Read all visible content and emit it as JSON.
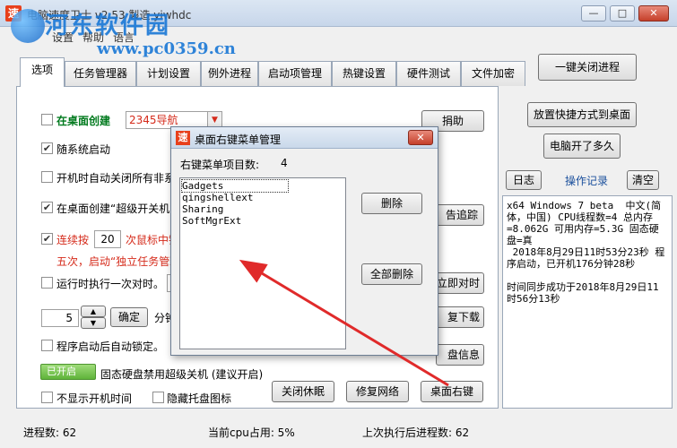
{
  "window": {
    "title": "电脑速度卫士 v2.53  製造 yiwhdc",
    "minimize_glyph": "—",
    "maximize_glyph": "□",
    "close_glyph": "✕"
  },
  "watermark": {
    "line1": "河东软件园",
    "line2": "www.pc0359.cn"
  },
  "menu": [
    "设置",
    "帮助",
    "语言"
  ],
  "tabs": [
    "选项",
    "任务管理器",
    "计划设置",
    "例外进程",
    "启动项管理",
    "热键设置",
    "硬件测试",
    "文件加密"
  ],
  "top_button": "一键关闭进程",
  "options": {
    "desktop_create": "在桌面创建",
    "desktop_select_value": "2345导航",
    "donate": "捐助",
    "autostart": "随系统启动",
    "close_on_boot": "开机时自动关闭所有非系",
    "create_superkey": "在桌面创建“超级开关机",
    "report_trace": "告追踪",
    "consecutive_press": "连续按",
    "press_count": "20",
    "press_suffix": "次鼠标中键",
    "fivetimes": "五次，启动“独立任务管理",
    "run_sync": "运行时执行一次对时。",
    "sync_now": "立即对时",
    "minutes_value": "5",
    "confirm": "确定",
    "minutes_label": "分钟",
    "repeat_download": "复下载",
    "auto_lock": "程序启动后自动锁定。",
    "disk_info": "盘信息",
    "toggle_on": "已开启",
    "ssd_disable": "固态硬盘禁用超级关机 (建议开启)",
    "hide_boot_time": "不显示开机时间",
    "hide_tray": "隐藏托盘图标",
    "close_hibernate": "关闭休眠",
    "repair_network": "修复网络",
    "desktop_rightclick": "桌面右键"
  },
  "side": {
    "place_shortcut": "放置快捷方式到桌面",
    "uptime": "电脑开了多久",
    "log": "日志",
    "op_record": "操作记录",
    "clear": "清空",
    "log_text": "x64 Windows 7 beta  中文(简体，中国) CPU线程数=4 总内存=8.062G 可用内存=5.3G 固态硬盘=真\n 2018年8月29日11时53分23秒 程序启动，已开机176分钟28秒\n\n时间同步成功于2018年8月29日11时56分13秒"
  },
  "status": {
    "process_count": "进程数:  62",
    "cpu": "当前cpu占用:  5%",
    "last_process_count": "上次执行后进程数:  62"
  },
  "dialog": {
    "title": "桌面右键菜单管理",
    "close_glyph": "✕",
    "count_label": "右键菜单项目数:",
    "count_value": "4",
    "items": [
      "Gadgets",
      "qingshellext",
      "Sharing",
      "SoftMgrExt"
    ],
    "delete": "删除",
    "delete_all": "全部删除"
  },
  "colors": {
    "accent_red": "#d52a1a",
    "arrow_red": "#e02a2a",
    "toggle_green": "#5fb33a"
  }
}
